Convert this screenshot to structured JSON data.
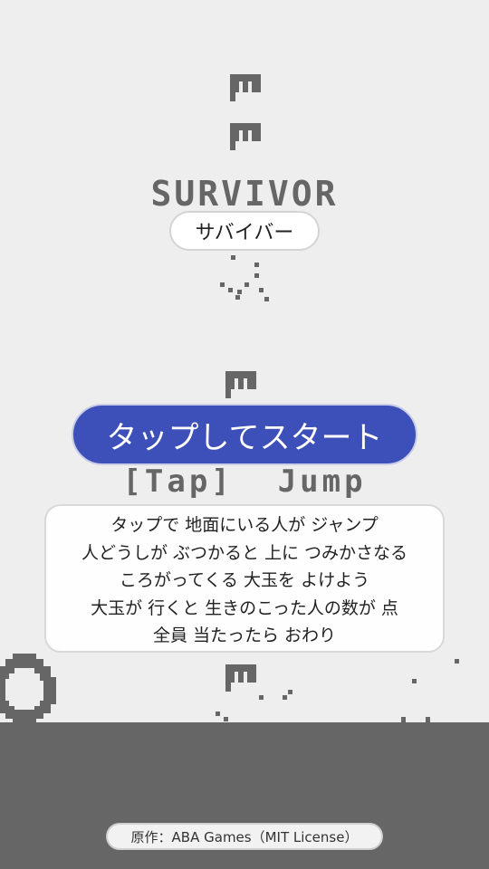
{
  "game": {
    "title_pixel": "SURVIVOR",
    "title_jp": "サバイバー",
    "start_label": "タップしてスタート",
    "controls_hint": "[Tap]  Jump",
    "instructions": [
      "タップで 地面にいる人が ジャンプ",
      "人どうしが ぶつかると 上に つみかさなる",
      "ころがってくる 大玉を よけよう",
      "大玉が 行くと 生きのこった人の数が 点",
      "全員 当たったら おわり"
    ],
    "credit": "原作：ABA Games（MIT License）"
  },
  "sprites": {
    "people": [
      "person-sprite",
      "person-sprite",
      "person-sprite",
      "person-sprite",
      "person-sprite"
    ],
    "ball": "rolling-ball-sprite"
  },
  "colors": {
    "background": "#eeeeee",
    "pixel_gray": "#666666",
    "start_button": "#3d4fb8",
    "ground": "#666666"
  }
}
